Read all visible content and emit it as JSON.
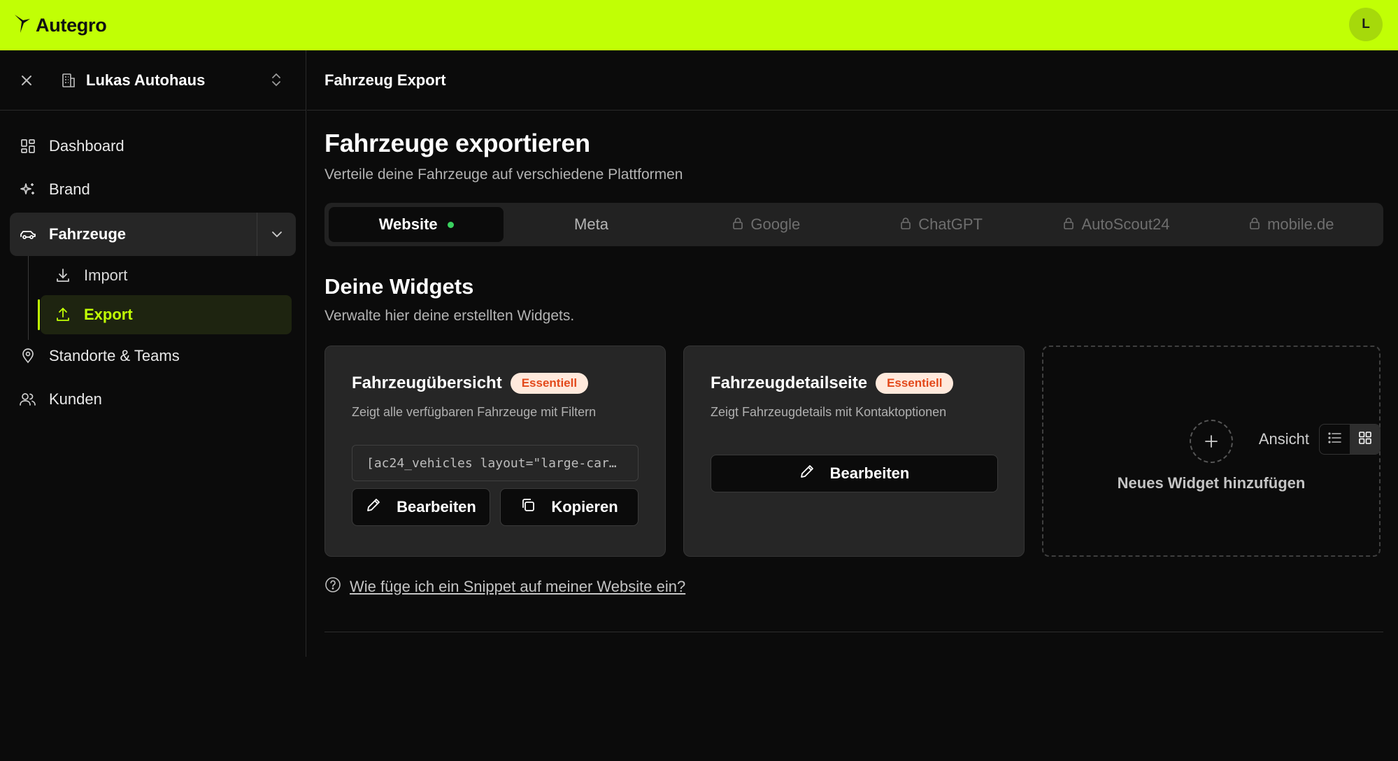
{
  "app": {
    "name": "Autegro",
    "avatar_initial": "L"
  },
  "sidebar": {
    "org_name": "Lukas Autohaus",
    "items": [
      {
        "label": "Dashboard"
      },
      {
        "label": "Brand"
      },
      {
        "label": "Fahrzeuge"
      },
      {
        "label": "Standorte & Teams"
      },
      {
        "label": "Kunden"
      }
    ],
    "sub_items": [
      {
        "label": "Import"
      },
      {
        "label": "Export"
      }
    ]
  },
  "header": {
    "title": "Fahrzeug Export"
  },
  "page": {
    "title": "Fahrzeuge exportieren",
    "subtitle": "Verteile deine Fahrzeuge auf verschiedene Plattformen"
  },
  "tabs": [
    {
      "label": "Website",
      "active": true,
      "locked": false,
      "status_color": "#3ad15f"
    },
    {
      "label": "Meta",
      "active": false,
      "locked": false
    },
    {
      "label": "Google",
      "active": false,
      "locked": true
    },
    {
      "label": "ChatGPT",
      "active": false,
      "locked": true
    },
    {
      "label": "AutoScout24",
      "active": false,
      "locked": true
    },
    {
      "label": "mobile.de",
      "active": false,
      "locked": true
    }
  ],
  "widgets_section": {
    "title": "Deine Widgets",
    "subtitle": "Verwalte hier deine erstellten Widgets.",
    "view_label": "Ansicht",
    "view_mode": "grid"
  },
  "widgets": [
    {
      "title": "Fahrzeugübersicht",
      "badge": "Essentiell",
      "description": "Zeigt alle verfügbaren Fahrzeuge mit Filtern",
      "snippet": "[ac24_vehicles layout=\"large-car…",
      "edit_label": "Bearbeiten",
      "copy_label": "Kopieren"
    },
    {
      "title": "Fahrzeugdetailseite",
      "badge": "Essentiell",
      "description": "Zeigt Fahrzeugdetails mit Kontaktoptionen",
      "edit_label": "Bearbeiten"
    }
  ],
  "add_widget_label": "Neues Widget hinzufügen",
  "help_link": "Wie füge ich ein Snippet auf meiner Website ein?",
  "colors": {
    "accent": "#c1ff05",
    "badge_text": "#e3491b",
    "badge_bg": "#ffe9dc",
    "background": "#0b0b0b"
  }
}
